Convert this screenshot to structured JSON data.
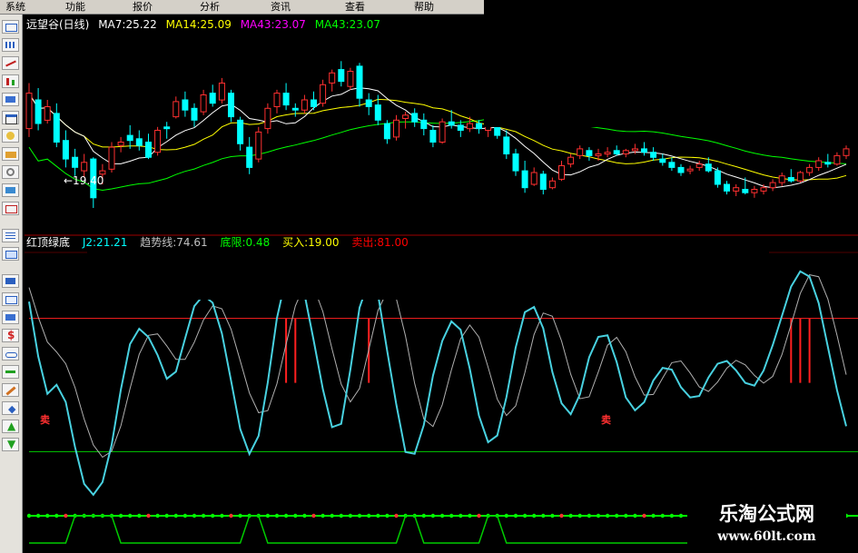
{
  "menu": [
    "系统",
    "功能",
    "报价",
    "分析",
    "资讯",
    "查看",
    "帮助"
  ],
  "main": {
    "stock_title": "远望谷(日线)",
    "ma": [
      {
        "label": "MA7:25.22",
        "color": "#ffffff"
      },
      {
        "label": "MA14:25.09",
        "color": "#ffff00"
      },
      {
        "label": "MA43:23.07",
        "color": "#ff00ff"
      },
      {
        "label": "MA43:23.07",
        "color": "#00ff00"
      }
    ],
    "low_annotation": "←19.40",
    "low_price": 19.4,
    "price_range": [
      18.0,
      30.0
    ]
  },
  "indicator": {
    "name": "红顶绿底",
    "values": [
      {
        "label": "J2:21.21",
        "color": "#00ffff"
      },
      {
        "label": "趋势线:74.61",
        "color": "#c0c0c0"
      },
      {
        "label": "底限:0.48",
        "color": "#00ff00"
      },
      {
        "label": "买入:19.00",
        "color": "#ffff00"
      },
      {
        "label": "卖出:81.00",
        "color": "#ff0000"
      }
    ],
    "marker": "卖",
    "range": [
      -10,
      110
    ],
    "levels": {
      "sell": 81.0,
      "buy": 19.0,
      "floor": 0.48
    }
  },
  "colors": {
    "up": "#ff3030",
    "down": "#00ffff",
    "ma_fast": "#ffffff",
    "ma_mid": "#ffff00",
    "ma_slow": "#00ff00",
    "j_line": "#48d1e0",
    "trend_line": "#b0b0b0",
    "divider": "#a00000"
  },
  "toolbar_icons": [
    "chart-icon",
    "grid-icon",
    "line-icon",
    "bar-icon",
    "table-icon",
    "money-icon",
    "pen-icon",
    "arrow-icon",
    "plus-icon",
    "up-icon",
    "down-icon"
  ],
  "chart_data": {
    "type": "line",
    "x_count": 90,
    "candles_ohlc": [
      [
        24.1,
        26.8,
        23.6,
        26.2
      ],
      [
        25.8,
        26.5,
        24.0,
        24.4
      ],
      [
        24.6,
        25.8,
        24.4,
        25.4
      ],
      [
        25.0,
        25.6,
        23.0,
        23.3
      ],
      [
        23.4,
        24.0,
        21.8,
        22.3
      ],
      [
        22.4,
        22.9,
        21.3,
        21.8
      ],
      [
        21.6,
        22.6,
        21.2,
        22.1
      ],
      [
        22.3,
        22.4,
        19.4,
        20.0
      ],
      [
        21.4,
        22.0,
        20.8,
        21.6
      ],
      [
        21.7,
        23.3,
        21.5,
        23.0
      ],
      [
        23.1,
        23.6,
        22.7,
        23.3
      ],
      [
        23.7,
        24.3,
        22.9,
        23.4
      ],
      [
        23.5,
        24.0,
        22.8,
        23.1
      ],
      [
        23.3,
        23.8,
        22.3,
        22.4
      ],
      [
        22.7,
        24.2,
        22.5,
        24.0
      ],
      [
        24.2,
        24.5,
        23.5,
        24.1
      ],
      [
        24.8,
        26.0,
        24.7,
        25.7
      ],
      [
        25.8,
        26.3,
        24.8,
        25.2
      ],
      [
        25.3,
        25.6,
        24.2,
        24.6
      ],
      [
        25.1,
        26.4,
        24.9,
        26.1
      ],
      [
        26.2,
        26.7,
        25.4,
        25.6
      ],
      [
        25.8,
        27.1,
        25.6,
        26.8
      ],
      [
        26.2,
        26.4,
        24.5,
        24.8
      ],
      [
        24.6,
        24.8,
        22.8,
        23.2
      ],
      [
        23.0,
        23.6,
        21.4,
        21.8
      ],
      [
        22.3,
        24.2,
        22.1,
        23.9
      ],
      [
        24.1,
        25.6,
        23.8,
        25.3
      ],
      [
        25.4,
        26.4,
        25.0,
        26.2
      ],
      [
        26.2,
        26.8,
        25.2,
        25.5
      ],
      [
        25.3,
        25.6,
        24.8,
        25.2
      ],
      [
        25.2,
        26.1,
        25.0,
        25.8
      ],
      [
        25.8,
        26.3,
        25.2,
        25.4
      ],
      [
        25.6,
        27.0,
        25.4,
        26.7
      ],
      [
        26.8,
        27.6,
        26.3,
        27.4
      ],
      [
        27.6,
        28.1,
        26.6,
        26.9
      ],
      [
        26.6,
        27.7,
        26.4,
        27.5
      ],
      [
        27.8,
        28.0,
        25.4,
        25.9
      ],
      [
        25.8,
        26.2,
        24.9,
        25.4
      ],
      [
        25.5,
        26.1,
        24.3,
        24.6
      ],
      [
        24.4,
        24.6,
        23.2,
        23.5
      ],
      [
        23.6,
        24.9,
        23.4,
        24.6
      ],
      [
        24.7,
        25.1,
        24.1,
        24.9
      ],
      [
        25.0,
        25.3,
        24.2,
        24.5
      ],
      [
        24.6,
        25.0,
        23.7,
        24.1
      ],
      [
        24.0,
        24.3,
        23.0,
        23.3
      ],
      [
        23.3,
        24.7,
        23.2,
        24.5
      ],
      [
        24.5,
        25.2,
        24.1,
        24.3
      ],
      [
        24.3,
        24.6,
        23.6,
        24.0
      ],
      [
        24.1,
        24.8,
        23.9,
        24.4
      ],
      [
        24.4,
        24.6,
        23.8,
        24.1
      ],
      [
        24.0,
        24.5,
        23.6,
        24.3
      ],
      [
        24.4,
        24.8,
        23.5,
        23.7
      ],
      [
        23.6,
        24.0,
        22.3,
        22.6
      ],
      [
        22.6,
        22.9,
        21.3,
        21.6
      ],
      [
        21.6,
        22.2,
        20.3,
        20.6
      ],
      [
        20.8,
        21.8,
        20.7,
        21.5
      ],
      [
        21.4,
        21.6,
        20.2,
        20.5
      ],
      [
        20.6,
        21.2,
        20.5,
        21.0
      ],
      [
        21.1,
        22.2,
        21.0,
        21.9
      ],
      [
        22.0,
        22.6,
        21.8,
        22.4
      ],
      [
        22.5,
        23.1,
        22.3,
        22.9
      ],
      [
        22.8,
        23.0,
        22.2,
        22.5
      ],
      [
        22.5,
        22.9,
        22.2,
        22.6
      ],
      [
        22.6,
        23.0,
        22.4,
        22.7
      ],
      [
        22.8,
        23.1,
        22.5,
        22.6
      ],
      [
        22.6,
        22.9,
        22.4,
        22.8
      ],
      [
        22.8,
        23.2,
        22.6,
        22.9
      ],
      [
        22.9,
        23.3,
        22.5,
        22.7
      ],
      [
        22.7,
        23.0,
        22.2,
        22.4
      ],
      [
        22.3,
        22.6,
        21.9,
        22.1
      ],
      [
        22.1,
        22.4,
        21.6,
        21.8
      ],
      [
        21.8,
        22.0,
        21.3,
        21.5
      ],
      [
        21.6,
        21.9,
        21.4,
        21.7
      ],
      [
        21.8,
        22.2,
        21.6,
        22.0
      ],
      [
        22.0,
        22.4,
        21.5,
        21.6
      ],
      [
        21.6,
        21.8,
        20.6,
        20.8
      ],
      [
        20.8,
        21.0,
        20.2,
        20.4
      ],
      [
        20.4,
        20.8,
        20.1,
        20.6
      ],
      [
        20.5,
        21.2,
        20.2,
        20.3
      ],
      [
        20.3,
        20.7,
        20.0,
        20.5
      ],
      [
        20.4,
        20.8,
        20.2,
        20.6
      ],
      [
        20.6,
        21.1,
        20.4,
        20.9
      ],
      [
        20.9,
        21.5,
        20.7,
        21.3
      ],
      [
        21.2,
        21.7,
        20.9,
        21.0
      ],
      [
        21.0,
        21.6,
        20.9,
        21.5
      ],
      [
        21.5,
        22.0,
        21.3,
        21.8
      ],
      [
        21.8,
        22.4,
        21.6,
        22.2
      ],
      [
        22.1,
        22.6,
        21.8,
        22.0
      ],
      [
        22.0,
        22.7,
        21.9,
        22.5
      ],
      [
        22.5,
        23.1,
        22.3,
        22.9
      ]
    ],
    "j2": [
      88.8,
      63.3,
      45.9,
      50.1,
      42.1,
      21.2,
      4.0,
      -1.1,
      4.8,
      22.2,
      47.8,
      69.0,
      76.2,
      72.3,
      63.9,
      52.9,
      56.2,
      71.7,
      86.7,
      91.8,
      88.3,
      74.0,
      52.0,
      29.5,
      17.9,
      26.3,
      51.1,
      81.1,
      100.2,
      102.8,
      92.3,
      70.7,
      48.1,
      30.4,
      31.9,
      57.2,
      86.0,
      98.4,
      92.3,
      66.0,
      40.9,
      18.8,
      18.0,
      31.4,
      54.4,
      70.5,
      79.6,
      75.7,
      57.6,
      35.7,
      23.4,
      26.5,
      44.4,
      67.5,
      83.9,
      86.3,
      76.4,
      56.0,
      41.5,
      36.4,
      45.5,
      62.9,
      72.4,
      73.1,
      60.7,
      44.2,
      38.2,
      42.0,
      52.1,
      58.0,
      57.2,
      49.0,
      44.2,
      44.9,
      53.5,
      59.9,
      61.2,
      56.8,
      51.0,
      49.7,
      56.7,
      68.6,
      82.1,
      95.8,
      102.9,
      100.4,
      88.1,
      67.8,
      47.6,
      30.8
    ],
    "trend": [
      95.4,
      81.6,
      70.0,
      65.4,
      59.9,
      48.9,
      34.1,
      22.1,
      16.4,
      19.2,
      31.0,
      48.3,
      64.3,
      73.1,
      73.8,
      68.2,
      61.9,
      61.9,
      69.9,
      80.3,
      86.8,
      85.5,
      76.0,
      61.3,
      46.3,
      37.1,
      38.1,
      50.6,
      69.0,
      86.8,
      96.6,
      95.6,
      84.2,
      66.8,
      50.4,
      42.1,
      48.4,
      66.5,
      84.6,
      93.7,
      90.2,
      72.8,
      50.7,
      34.2,
      30.7,
      40.8,
      57.0,
      71.5,
      77.9,
      72.3,
      58.3,
      43.4,
      35.8,
      40.3,
      55.8,
      73.5,
      83.5,
      82.0,
      70.5,
      55.0,
      43.6,
      44.5,
      56.1,
      68.5,
      72.2,
      65.5,
      53.8,
      45.3,
      45.6,
      53.2,
      60.4,
      61.2,
      55.6,
      49.1,
      47.0,
      51.4,
      57.8,
      61.5,
      59.4,
      54.5,
      50.9,
      54.0,
      64.1,
      78.1,
      92.6,
      101.3,
      100.4,
      90.0,
      73.1,
      54.8
    ]
  }
}
